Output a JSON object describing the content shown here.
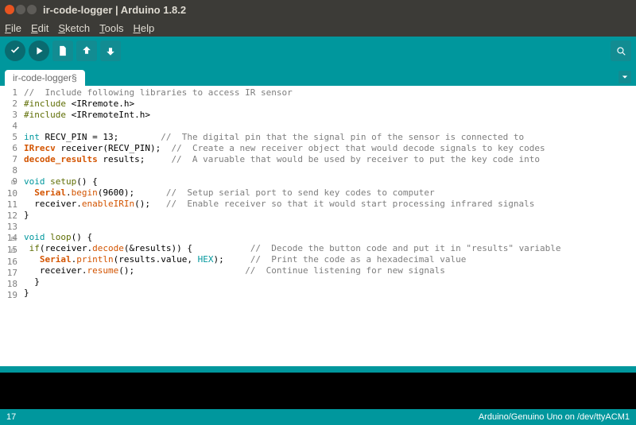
{
  "window": {
    "title": "ir-code-logger | Arduino 1.8.2"
  },
  "menu": {
    "file": "File",
    "edit": "Edit",
    "sketch": "Sketch",
    "tools": "Tools",
    "help": "Help"
  },
  "tab": {
    "name": "ir-code-logger§"
  },
  "status": {
    "left": "17",
    "right": "Arduino/Genuino Uno on /dev/ttyACM1"
  },
  "code": {
    "l1": "//  Include following libraries to access IR sensor",
    "l2a": "#include ",
    "l2b": "<IRremote.h>",
    "l3a": "#include ",
    "l3b": "<IRremoteInt.h>",
    "l5a": "int",
    "l5b": " RECV_PIN = 13;        ",
    "l5c": "//  The digital pin that the signal pin of the sensor is connected to",
    "l6a": "IRrecv",
    "l6b": " receiver(RECV_PIN);  ",
    "l6c": "//  Create a new receiver object that would decode signals to key codes",
    "l7a": "decode_results",
    "l7b": " results;     ",
    "l7c": "//  A varuable that would be used by receiver to put the key code into",
    "l9a": "void",
    "l9b": " ",
    "l9c": "setup",
    "l9d": "() {",
    "l10a": "  ",
    "l10b": "Serial",
    "l10c": ".",
    "l10d": "begin",
    "l10e": "(9600);      ",
    "l10f": "//  Setup serial port to send key codes to computer",
    "l11a": "  receiver.",
    "l11b": "enableIRIn",
    "l11c": "();   ",
    "l11d": "//  Enable receiver so that it would start processing infrared signals",
    "l12": "}",
    "l14a": "void",
    "l14b": " ",
    "l14c": "loop",
    "l14d": "() {",
    "l15a": " ",
    "l15b": "if",
    "l15c": "(receiver.",
    "l15d": "decode",
    "l15e": "(&results)) {           ",
    "l15f": "//  Decode the button code and put it in \"results\" variable",
    "l16a": "   ",
    "l16b": "Serial",
    "l16c": ".",
    "l16d": "println",
    "l16e": "(results.value, ",
    "l16f": "HEX",
    "l16g": ");     ",
    "l16h": "//  Print the code as a hexadecimal value",
    "l17a": "   receiver.",
    "l17b": "resume",
    "l17c": "();                     ",
    "l17d": "//  Continue listening for new signals",
    "l18": "  }",
    "l19": "}"
  },
  "lines": [
    "1",
    "2",
    "3",
    "4",
    "5",
    "6",
    "7",
    "8",
    "9",
    "10",
    "11",
    "12",
    "13",
    "14",
    "15",
    "16",
    "17",
    "18",
    "19"
  ]
}
